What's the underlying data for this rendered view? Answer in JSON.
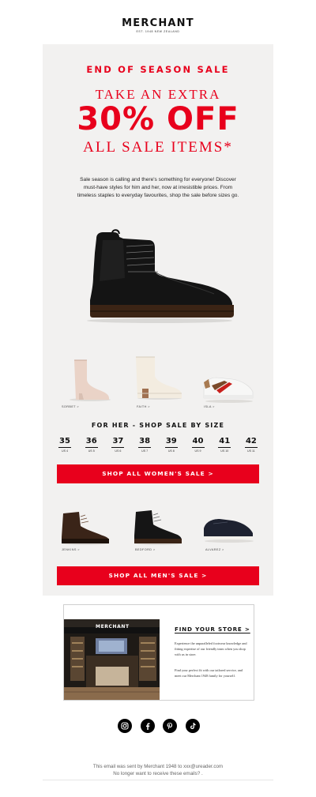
{
  "brand": {
    "name": "MERCHANT",
    "tagline": "EST. 1948 NEW ZEALAND"
  },
  "hero": {
    "headline": "END OF SEASON SALE",
    "line1": "TAKE AN EXTRA",
    "discount": "30% OFF",
    "line3": "ALL SALE ITEMS*",
    "intro": "Sale season is calling and there's something for everyone! Discover must-have styles for him and her, now at irresistible prices. From timeless staples to everyday favourites, shop the sale before sizes go."
  },
  "women_products": [
    {
      "label": "SORBET >"
    },
    {
      "label": "FAITH >"
    },
    {
      "label": "ISLA >"
    }
  ],
  "sizes_section": {
    "title": "FOR HER - SHOP SALE BY SIZE",
    "sizes": [
      {
        "eu": "35",
        "us": "US 4"
      },
      {
        "eu": "36",
        "us": "US 5"
      },
      {
        "eu": "37",
        "us": "US 6"
      },
      {
        "eu": "38",
        "us": "US 7"
      },
      {
        "eu": "39",
        "us": "US 8"
      },
      {
        "eu": "40",
        "us": "US 9"
      },
      {
        "eu": "41",
        "us": "US 10"
      },
      {
        "eu": "42",
        "us": "US 11"
      }
    ]
  },
  "women_cta": "SHOP ALL WOMEN'S SALE >",
  "men_products": [
    {
      "label": "JENKINS >"
    },
    {
      "label": "BEDFORD >"
    },
    {
      "label": "ALVAREZ >"
    }
  ],
  "men_cta": "SHOP ALL MEN'S SALE >",
  "store": {
    "title": "FIND YOUR STORE >",
    "sign": "MERCHANT",
    "p1": "Experience the unparalleled footwear knowledge and fitting expertise of our friendly team when you shop with us in store.",
    "p2": "Find your perfect fit with our tailored service, and meet our Merchant 1948 family for yourself."
  },
  "social_icons": [
    "instagram-icon",
    "facebook-icon",
    "pinterest-icon",
    "tiktok-icon"
  ],
  "footer": {
    "line1": "This email was sent by Merchant 1948 to xxx@ureader.com",
    "line2": "No longer want to receive these emails? ."
  },
  "colors": {
    "accent": "#e8001c",
    "card": "#f2f1f0"
  }
}
